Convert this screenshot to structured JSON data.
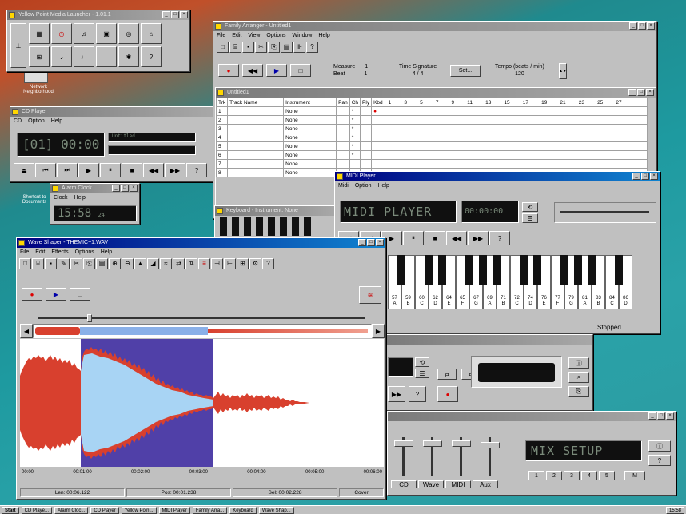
{
  "desktop": {
    "network_label": "Network Neighborhood",
    "shortcut_label": "Shortcut to Documents"
  },
  "media_launcher": {
    "title": "Yellow Point Media Launcher - 1.01.1"
  },
  "cd_player": {
    "title": "CD Player",
    "menu": [
      "CD",
      "Option",
      "Help"
    ],
    "time": "[01] 00:00",
    "lcd_text": "Untitled"
  },
  "alarm_clock": {
    "title": "Alarm Clock",
    "menu": [
      "Clock",
      "Help"
    ],
    "time": "15:58",
    "seconds": "24"
  },
  "music_arranger": {
    "title": "Family Arranger - Untitled1",
    "menu": [
      "File",
      "Edit",
      "View",
      "Options",
      "Window",
      "Help"
    ],
    "measure_label": "Measure",
    "measure_value": "1",
    "beat_label": "Beat",
    "beat_value": "1",
    "timesig_label": "Time Signature",
    "timesig_value": "4 / 4",
    "set_button": "Set...",
    "tempo_label": "Tempo (beats / min)",
    "tempo_value": "120",
    "doc_title": "Untitled1",
    "columns": [
      "Trk",
      "Track Name",
      "Instrument",
      "Pan",
      "Ch",
      "Ply",
      "Kbd"
    ],
    "measure_numbers": [
      "1",
      "3",
      "5",
      "7",
      "9",
      "11",
      "13",
      "15",
      "17",
      "19",
      "21",
      "23",
      "25",
      "27"
    ],
    "rows": [
      {
        "trk": "1",
        "inst": "None",
        "ch": "*"
      },
      {
        "trk": "2",
        "inst": "None",
        "ch": "*"
      },
      {
        "trk": "3",
        "inst": "None",
        "ch": "*"
      },
      {
        "trk": "4",
        "inst": "None",
        "ch": "*"
      },
      {
        "trk": "5",
        "inst": "None",
        "ch": "*"
      },
      {
        "trk": "6",
        "inst": "None",
        "ch": "*"
      },
      {
        "trk": "7",
        "inst": "None",
        "ch": ""
      },
      {
        "trk": "8",
        "inst": "None",
        "ch": ""
      }
    ],
    "keyboard_title": "Keyboard - Instrument: None"
  },
  "midi_player": {
    "title": "MIDI Player",
    "menu": [
      "Midi",
      "Option",
      "Help"
    ],
    "lcd_text": "MIDI PLAYER",
    "status": "Stopped",
    "key_notes": [
      "57",
      "59",
      "60",
      "62",
      "64",
      "65",
      "67",
      "69",
      "71",
      "72",
      "74",
      "76",
      "77",
      "79",
      "81",
      "83",
      "84",
      "86"
    ],
    "key_letters": [
      "A",
      "B",
      "C",
      "D",
      "E",
      "F",
      "G",
      "A",
      "B",
      "C",
      "D",
      "E",
      "F",
      "G",
      "A",
      "B",
      "C",
      "D"
    ]
  },
  "wave_shaper": {
    "title": "Wave Shaper - THEMIC~1.WAV",
    "menu": [
      "File",
      "Edit",
      "Effects",
      "Options",
      "Help"
    ],
    "time_labels": [
      "00:00",
      "00:01:00",
      "00:02:00",
      "00:03:00",
      "00:04:00",
      "00:05:00",
      "00:06:00"
    ],
    "len": "Len: 00:06.122",
    "pos": "Pos: 00:01.238",
    "sel": "Sel: 00:02.228",
    "mode": "Cover"
  },
  "mixer": {
    "lcd_text": "MIX SETUP",
    "channels": [
      "CD",
      "Wave",
      "MIDI",
      "Aux"
    ],
    "presets": [
      "1",
      "2",
      "3",
      "4",
      "5"
    ],
    "mute_label": "M"
  },
  "taskbar": {
    "start": "Start",
    "items": [
      "CD Playe...",
      "Alarm Cloc...",
      "CD Player",
      "Yellow Poin...",
      "MIDI Player",
      "Family Arra...",
      "Keyboard",
      "Wave Shap..."
    ],
    "clock": "15:58"
  }
}
